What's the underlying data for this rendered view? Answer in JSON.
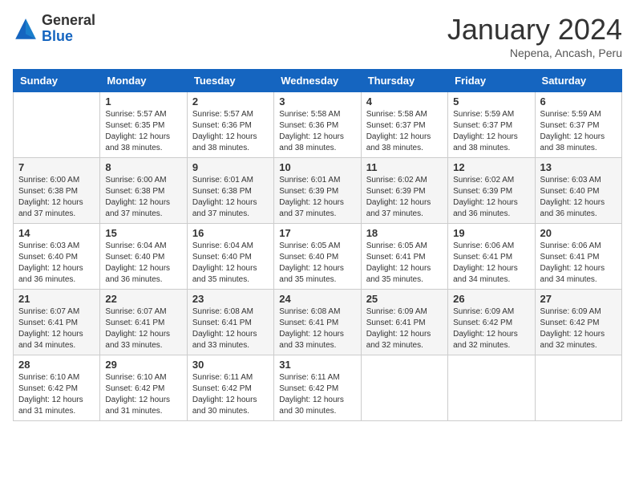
{
  "header": {
    "logo_general": "General",
    "logo_blue": "Blue",
    "month_title": "January 2024",
    "subtitle": "Nepena, Ancash, Peru"
  },
  "days_of_week": [
    "Sunday",
    "Monday",
    "Tuesday",
    "Wednesday",
    "Thursday",
    "Friday",
    "Saturday"
  ],
  "weeks": [
    [
      {
        "day": "",
        "sunrise": "",
        "sunset": "",
        "daylight": ""
      },
      {
        "day": "1",
        "sunrise": "5:57 AM",
        "sunset": "6:35 PM",
        "daylight": "12 hours and 38 minutes."
      },
      {
        "day": "2",
        "sunrise": "5:57 AM",
        "sunset": "6:36 PM",
        "daylight": "12 hours and 38 minutes."
      },
      {
        "day": "3",
        "sunrise": "5:58 AM",
        "sunset": "6:36 PM",
        "daylight": "12 hours and 38 minutes."
      },
      {
        "day": "4",
        "sunrise": "5:58 AM",
        "sunset": "6:37 PM",
        "daylight": "12 hours and 38 minutes."
      },
      {
        "day": "5",
        "sunrise": "5:59 AM",
        "sunset": "6:37 PM",
        "daylight": "12 hours and 38 minutes."
      },
      {
        "day": "6",
        "sunrise": "5:59 AM",
        "sunset": "6:37 PM",
        "daylight": "12 hours and 38 minutes."
      }
    ],
    [
      {
        "day": "7",
        "sunrise": "6:00 AM",
        "sunset": "6:38 PM",
        "daylight": "12 hours and 37 minutes."
      },
      {
        "day": "8",
        "sunrise": "6:00 AM",
        "sunset": "6:38 PM",
        "daylight": "12 hours and 37 minutes."
      },
      {
        "day": "9",
        "sunrise": "6:01 AM",
        "sunset": "6:38 PM",
        "daylight": "12 hours and 37 minutes."
      },
      {
        "day": "10",
        "sunrise": "6:01 AM",
        "sunset": "6:39 PM",
        "daylight": "12 hours and 37 minutes."
      },
      {
        "day": "11",
        "sunrise": "6:02 AM",
        "sunset": "6:39 PM",
        "daylight": "12 hours and 37 minutes."
      },
      {
        "day": "12",
        "sunrise": "6:02 AM",
        "sunset": "6:39 PM",
        "daylight": "12 hours and 36 minutes."
      },
      {
        "day": "13",
        "sunrise": "6:03 AM",
        "sunset": "6:40 PM",
        "daylight": "12 hours and 36 minutes."
      }
    ],
    [
      {
        "day": "14",
        "sunrise": "6:03 AM",
        "sunset": "6:40 PM",
        "daylight": "12 hours and 36 minutes."
      },
      {
        "day": "15",
        "sunrise": "6:04 AM",
        "sunset": "6:40 PM",
        "daylight": "12 hours and 36 minutes."
      },
      {
        "day": "16",
        "sunrise": "6:04 AM",
        "sunset": "6:40 PM",
        "daylight": "12 hours and 35 minutes."
      },
      {
        "day": "17",
        "sunrise": "6:05 AM",
        "sunset": "6:40 PM",
        "daylight": "12 hours and 35 minutes."
      },
      {
        "day": "18",
        "sunrise": "6:05 AM",
        "sunset": "6:41 PM",
        "daylight": "12 hours and 35 minutes."
      },
      {
        "day": "19",
        "sunrise": "6:06 AM",
        "sunset": "6:41 PM",
        "daylight": "12 hours and 34 minutes."
      },
      {
        "day": "20",
        "sunrise": "6:06 AM",
        "sunset": "6:41 PM",
        "daylight": "12 hours and 34 minutes."
      }
    ],
    [
      {
        "day": "21",
        "sunrise": "6:07 AM",
        "sunset": "6:41 PM",
        "daylight": "12 hours and 34 minutes."
      },
      {
        "day": "22",
        "sunrise": "6:07 AM",
        "sunset": "6:41 PM",
        "daylight": "12 hours and 33 minutes."
      },
      {
        "day": "23",
        "sunrise": "6:08 AM",
        "sunset": "6:41 PM",
        "daylight": "12 hours and 33 minutes."
      },
      {
        "day": "24",
        "sunrise": "6:08 AM",
        "sunset": "6:41 PM",
        "daylight": "12 hours and 33 minutes."
      },
      {
        "day": "25",
        "sunrise": "6:09 AM",
        "sunset": "6:41 PM",
        "daylight": "12 hours and 32 minutes."
      },
      {
        "day": "26",
        "sunrise": "6:09 AM",
        "sunset": "6:42 PM",
        "daylight": "12 hours and 32 minutes."
      },
      {
        "day": "27",
        "sunrise": "6:09 AM",
        "sunset": "6:42 PM",
        "daylight": "12 hours and 32 minutes."
      }
    ],
    [
      {
        "day": "28",
        "sunrise": "6:10 AM",
        "sunset": "6:42 PM",
        "daylight": "12 hours and 31 minutes."
      },
      {
        "day": "29",
        "sunrise": "6:10 AM",
        "sunset": "6:42 PM",
        "daylight": "12 hours and 31 minutes."
      },
      {
        "day": "30",
        "sunrise": "6:11 AM",
        "sunset": "6:42 PM",
        "daylight": "12 hours and 30 minutes."
      },
      {
        "day": "31",
        "sunrise": "6:11 AM",
        "sunset": "6:42 PM",
        "daylight": "12 hours and 30 minutes."
      },
      {
        "day": "",
        "sunrise": "",
        "sunset": "",
        "daylight": ""
      },
      {
        "day": "",
        "sunrise": "",
        "sunset": "",
        "daylight": ""
      },
      {
        "day": "",
        "sunrise": "",
        "sunset": "",
        "daylight": ""
      }
    ]
  ],
  "labels": {
    "sunrise_prefix": "Sunrise: ",
    "sunset_prefix": "Sunset: ",
    "daylight_prefix": "Daylight: "
  }
}
